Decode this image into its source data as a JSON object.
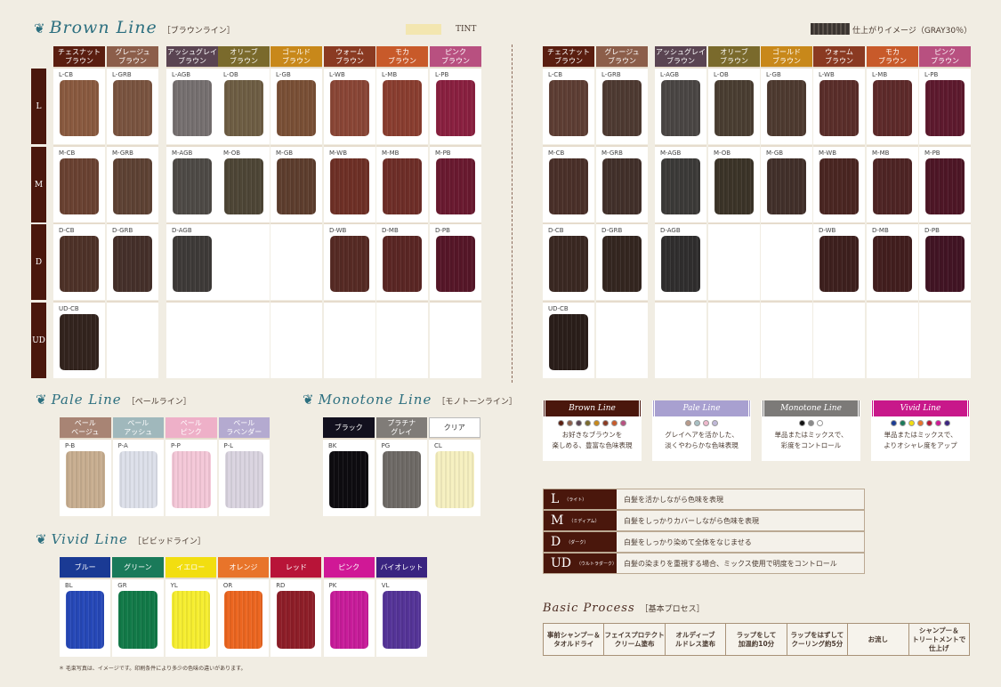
{
  "brown": {
    "title": "Brown Line",
    "subtitle": "［ブラウンライン］",
    "tint_label": "TINT",
    "gray_label": "仕上がりイメージ（GRAY30％）",
    "columns": [
      {
        "name": "チェスナット\nブラウン",
        "color": "#5a1e10"
      },
      {
        "name": "グレージュ\nブラウン",
        "color": "#8c5e4a"
      },
      {
        "name": "アッシュグレイ\nブラウン",
        "color": "#5a4452"
      },
      {
        "name": "オリーブ\nブラウン",
        "color": "#7a6a2c"
      },
      {
        "name": "ゴールド\nブラウン",
        "color": "#c8881a"
      },
      {
        "name": "ウォーム\nブラウン",
        "color": "#8a3a22"
      },
      {
        "name": "モカ\nブラウン",
        "color": "#c85a2a"
      },
      {
        "name": "ピンク\nブラウン",
        "color": "#b85080"
      }
    ],
    "rows": [
      {
        "level": "L",
        "codes": [
          "L-CB",
          "L-GRB",
          "L-AGB",
          "L-OB",
          "L-GB",
          "L-WB",
          "L-MB",
          "L-PB"
        ],
        "tint": [
          "#8a5a40",
          "#7a5440",
          "#767070",
          "#6e5e44",
          "#7a5036",
          "#8a4636",
          "#8a3e30",
          "#8a2040"
        ],
        "gray": [
          "#5e3e34",
          "#4e3a32",
          "#4a4644",
          "#4a3e32",
          "#4e3a30",
          "#5a2e2a",
          "#5e2a2a",
          "#5e1a2e"
        ]
      },
      {
        "level": "M",
        "codes": [
          "M-CB",
          "M-GRB",
          "M-AGB",
          "M-OB",
          "M-GB",
          "M-WB",
          "M-MB",
          "M-PB"
        ],
        "tint": [
          "#6a4232",
          "#5e4234",
          "#4e4a46",
          "#4e4636",
          "#5e3e2e",
          "#6e3026",
          "#6e2e28",
          "#6a1a30"
        ],
        "gray": [
          "#4a3029",
          "#42302a",
          "#3c3a38",
          "#3c3428",
          "#42302a",
          "#4a2622",
          "#4e2424",
          "#4e1626"
        ]
      },
      {
        "level": "D",
        "codes": [
          "D-CB",
          "D-GRB",
          "D-AGB",
          null,
          null,
          "D-WB",
          "D-MB",
          "D-PB"
        ],
        "tint": [
          "#4e3228",
          "#45302a",
          "#3e3a38",
          null,
          null,
          "#562a24",
          "#5a2624",
          "#561628"
        ],
        "gray": [
          "#3a2822",
          "#342620",
          "#302e2e",
          null,
          null,
          "#3e201e",
          "#421e1e",
          "#421424"
        ]
      },
      {
        "level": "UD",
        "codes": [
          "UD-CB",
          null,
          null,
          null,
          null,
          null,
          null,
          null
        ],
        "tint": [
          "#33241e",
          null,
          null,
          null,
          null,
          null,
          null,
          null
        ],
        "gray": [
          "#2a1e1a",
          null,
          null,
          null,
          null,
          null,
          null,
          null
        ]
      }
    ]
  },
  "pale": {
    "title": "Pale Line",
    "subtitle": "［ペールライン］",
    "items": [
      {
        "name": "ペール\nベージュ",
        "code": "P-B",
        "head": "#a88474",
        "color": "#c8ae90"
      },
      {
        "name": "ペール\nアッシュ",
        "code": "P-A",
        "head": "#a0b8bc",
        "color": "#dde0ea"
      },
      {
        "name": "ペール\nピンク",
        "code": "P-P",
        "head": "#eeb0c8",
        "color": "#f4c8d8"
      },
      {
        "name": "ペール\nラベンダー",
        "code": "P-L",
        "head": "#b4aad0",
        "color": "#dad4e0"
      }
    ]
  },
  "monotone": {
    "title": "Monotone Line",
    "subtitle": "［モノトーンライン］",
    "items": [
      {
        "name": "ブラック",
        "code": "BK",
        "head": "#12101e",
        "color": "#0e0c10"
      },
      {
        "name": "プラチナ\nグレイ",
        "code": "PG",
        "head": "#807c78",
        "color": "#6e6a66"
      },
      {
        "name": "クリア",
        "code": "CL",
        "head": "#ffffff",
        "color": "#f6f0c0"
      }
    ]
  },
  "vivid": {
    "title": "Vivid Line",
    "subtitle": "［ビビッドライン］",
    "items": [
      {
        "name": "ブルー",
        "code": "BL",
        "head": "#1a3a94",
        "color": "#2648b8"
      },
      {
        "name": "グリーン",
        "code": "GR",
        "head": "#1a7a5a",
        "color": "#127a48"
      },
      {
        "name": "イエロー",
        "code": "YL",
        "head": "#f2de10",
        "color": "#f6ee30"
      },
      {
        "name": "オレンジ",
        "code": "OR",
        "head": "#e8742a",
        "color": "#ec6620"
      },
      {
        "name": "レッド",
        "code": "RD",
        "head": "#b81438",
        "color": "#8e1e28"
      },
      {
        "name": "ピンク",
        "code": "PK",
        "head": "#d01896",
        "color": "#c81c9a"
      },
      {
        "name": "バイオレット",
        "code": "VL",
        "head": "#3a2480",
        "color": "#553498"
      }
    ]
  },
  "footnote": "＊ 毛束写真は、イメージです。印刷条件により多少の色味の違いがあります。",
  "line_cards": [
    {
      "title": "Brown Line",
      "bar": "#4a170c",
      "dots": [
        "#5a1e10",
        "#8c5e4a",
        "#5a4452",
        "#7a6a2c",
        "#c8881a",
        "#8a3a22",
        "#c85a2a",
        "#b85080"
      ],
      "desc": "お好きなブラウンを\n楽しめる、豊富な色味表現"
    },
    {
      "title": "Pale Line",
      "bar": "#a8a0d0",
      "dots": [
        "#b89a8a",
        "#a8c0c4",
        "#eeb8cc",
        "#c0b8d8"
      ],
      "desc": "グレイヘアを活かした、\n淡くやわらかな色味表現"
    },
    {
      "title": "Monotone Line",
      "bar": "#7c7a78",
      "dots": [
        "#101010",
        "#8a8a8a",
        "#ffffff"
      ],
      "desc": "単品またはミックスで、\n彩度をコントロール"
    },
    {
      "title": "Vivid Line",
      "bar": "#c8188a",
      "dots": [
        "#1a3a94",
        "#1a7a5a",
        "#f2de10",
        "#e8742a",
        "#b81438",
        "#d01896",
        "#3a2480"
      ],
      "desc": "単品またはミックスで、\nよりオシャレ度をアップ"
    }
  ],
  "levels": [
    {
      "key": "L",
      "reading": "（ライト）",
      "desc": "白髪を活かしながら色味を表現"
    },
    {
      "key": "M",
      "reading": "（ミディアム）",
      "desc": "白髪をしっかりカバーしながら色味を表現"
    },
    {
      "key": "D",
      "reading": "（ダーク）",
      "desc": "白髪をしっかり染めて全体をなじませる"
    },
    {
      "key": "UD",
      "reading": "（ウルトラダーク）",
      "desc": "白髪の染まりを重視する場合、ミックス使用で明度をコントロール"
    }
  ],
  "process": {
    "title": "Basic Process",
    "subtitle": "［基本プロセス］",
    "steps": [
      "事前シャンプー＆\nタオルドライ",
      "フェイスプロテクト\nクリーム塗布",
      "オルディーブ\nルドレス塗布",
      "ラップをして\n加温約10分",
      "ラップをはずして\nクーリング約5分",
      "お流し",
      "シャンプー＆\nトリートメントで\n仕上げ"
    ]
  }
}
